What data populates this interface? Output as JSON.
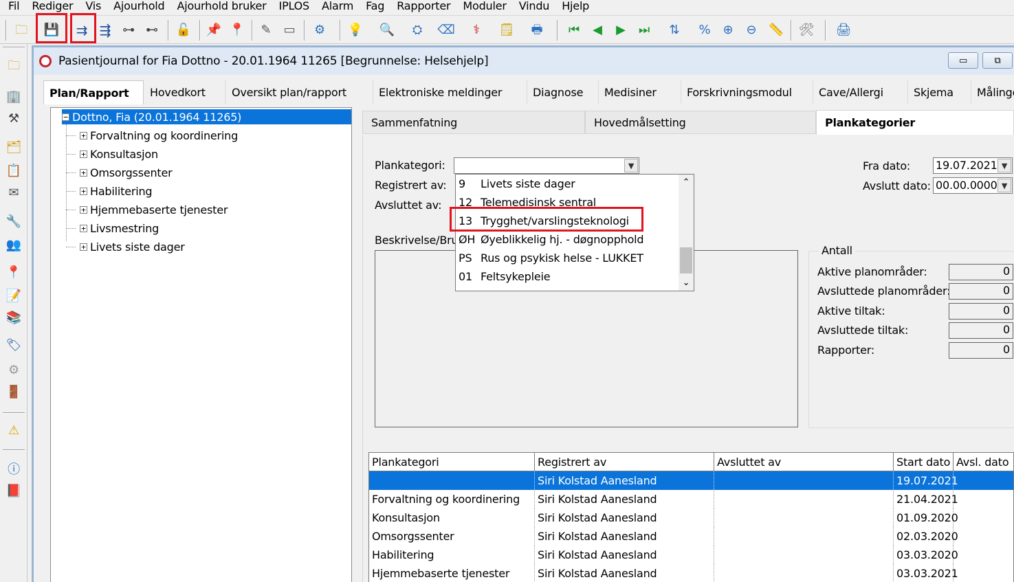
{
  "menu": [
    "Fil",
    "Rediger",
    "Vis",
    "Ajourhold",
    "Ajourhold bruker",
    "IPLOS",
    "Alarm",
    "Fag",
    "Rapporter",
    "Moduler",
    "Vindu",
    "Hjelp"
  ],
  "toolbar_icons": [
    "open-folder-icon",
    "save-icon",
    "indent-icon",
    "outdent-icon",
    "move-branch-icon",
    "move-branch-down-icon",
    "lock-icon",
    "pin-icon",
    "pin-multi-icon",
    "pen-icon",
    "card-icon",
    "gear-globe-icon",
    "lightbulb-icon",
    "search-icon",
    "binoculars-icon",
    "eraser-icon",
    "medical-icon",
    "notepad-icon",
    "print-icon",
    "first-record-icon",
    "previous-record-icon",
    "next-record-icon",
    "last-record-icon",
    "sort-icon",
    "percent-icon",
    "zoom-in-icon",
    "zoom-out-icon",
    "ruler-icon",
    "tools-icon",
    "printer-icon"
  ],
  "window": {
    "title": "Pasientjournal for Fia Dottno - 20.01.1964 11265   [Begrunnelse: Helsehjelp]",
    "minimize": "▭",
    "restore": "⧉"
  },
  "main_tabs": [
    "Plan/Rapport",
    "Hovedkort",
    "Oversikt plan/rapport",
    "Elektroniske meldinger",
    "Diagnose",
    "Medisiner",
    "Forskrivningsmodul",
    "Cave/Allergi",
    "Skjema",
    "Målinge"
  ],
  "tree": {
    "root": "Dottno, Fia (20.01.1964 11265)",
    "children": [
      "Forvaltning og koordinering",
      "Konsultasjon",
      "Omsorgssenter",
      "Habilitering",
      "Hjemmebaserte tjenester",
      "Livsmestring",
      "Livets siste dager"
    ]
  },
  "sub_tabs": [
    "Sammenfatning",
    "Hovedmålsetting",
    "Plankategorier"
  ],
  "form": {
    "plankategori_label": "Plankategori:",
    "registrert_label": "Registrert av:",
    "avsluttet_label": "Avsluttet av:",
    "beskrivelse_label": "Beskrivelse/Bru",
    "plankategori_value": "",
    "fra_dato_label": "Fra dato:",
    "fra_dato_value": "19.07.2021",
    "avslutt_dato_label": "Avslutt dato:",
    "avslutt_dato_value": "00.00.0000"
  },
  "dropdown": [
    {
      "code": "9",
      "name": "Livets siste dager"
    },
    {
      "code": "12",
      "name": "Telemedisinsk sentral"
    },
    {
      "code": "13",
      "name": "Trygghet/varslingsteknologi"
    },
    {
      "code": "ØH",
      "name": "Øyeblikkelig hj. - døgnopphold"
    },
    {
      "code": "PS",
      "name": "Rus og psykisk helse - LUKKET"
    },
    {
      "code": "01",
      "name": "Feltsykepleie"
    }
  ],
  "antall": {
    "title": "Antall",
    "rows": [
      {
        "label": "Aktive planområder:",
        "value": "0"
      },
      {
        "label": "Avsluttede planområder:",
        "value": "0"
      },
      {
        "label": "Aktive tiltak:",
        "value": "0"
      },
      {
        "label": "Avsluttede tiltak:",
        "value": "0"
      },
      {
        "label": "Rapporter:",
        "value": "0"
      }
    ]
  },
  "grid": {
    "columns": [
      "Plankategori",
      "Registrert av",
      "Avsluttet av",
      "Start dato",
      "Avsl. dato"
    ],
    "rows": [
      [
        "",
        "Siri Kolstad Aanesland",
        "",
        "19.07.2021",
        ""
      ],
      [
        "Forvaltning og koordinering",
        "Siri Kolstad Aanesland",
        "",
        "21.04.2021",
        ""
      ],
      [
        "Konsultasjon",
        "Siri Kolstad Aanesland",
        "",
        "01.09.2020",
        ""
      ],
      [
        "Omsorgssenter",
        "Siri Kolstad Aanesland",
        "",
        "02.03.2020",
        ""
      ],
      [
        "Habilitering",
        "Siri Kolstad Aanesland",
        "",
        "03.03.2020",
        ""
      ],
      [
        "Hjemmebaserte tjenester",
        "Siri Kolstad Aanesland",
        "",
        "03.03.2021",
        ""
      ]
    ]
  },
  "colors": {
    "highlight_red": "#e0141e",
    "selection_blue": "#0a74da",
    "title_bar": "#dfe9f5"
  }
}
